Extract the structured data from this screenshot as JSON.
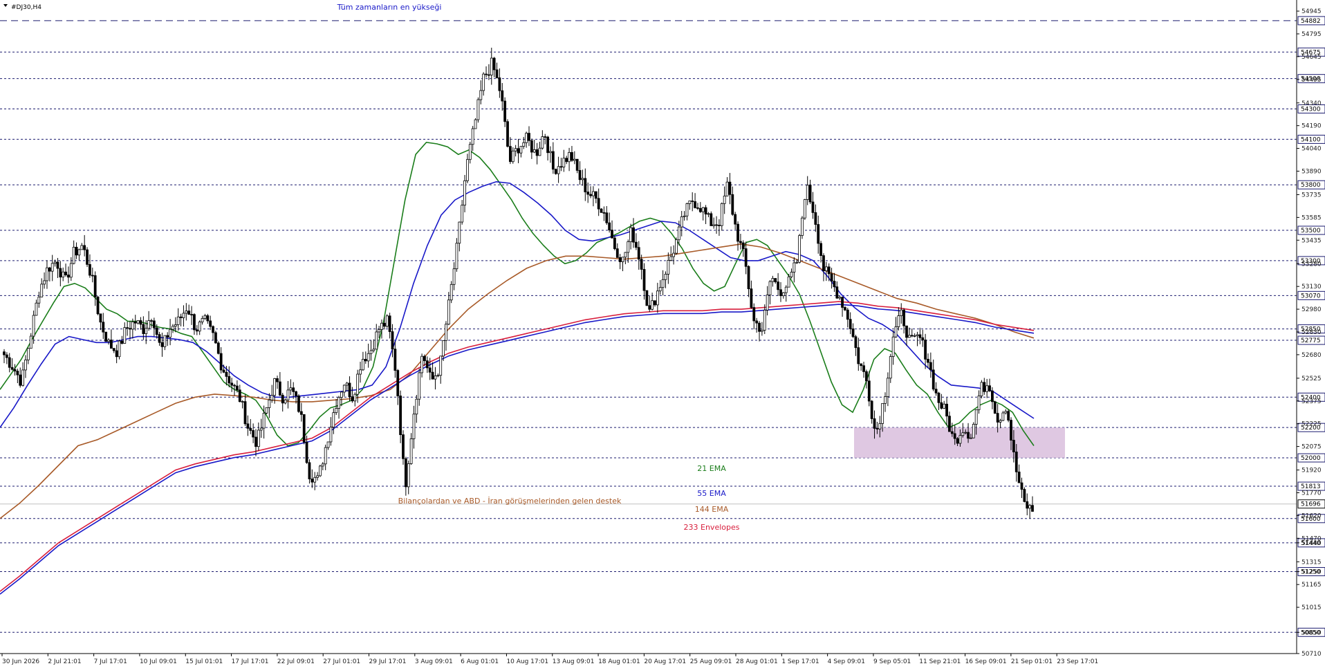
{
  "window": {
    "symbol_label": "#DJ30,H4",
    "menu_icon": "triangle-down-icon"
  },
  "chart_data": {
    "type": "candlestick",
    "title": "#DJ30,H4",
    "ylim": [
      50710,
      55000
    ],
    "x_ticks": [
      "30 Jun 2026",
      "2 Jul 21:01",
      "7 Jul 17:01",
      "10 Jul 09:01",
      "15 Jul 01:01",
      "17 Jul 17:01",
      "22 Jul 09:01",
      "27 Jul 01:01",
      "29 Jul 17:01",
      "3 Aug 09:01",
      "6 Aug 01:01",
      "10 Aug 17:01",
      "13 Aug 09:01",
      "18 Aug 01:01",
      "20 Aug 17:01",
      "25 Aug 09:01",
      "28 Aug 01:01",
      "1 Sep 17:01",
      "4 Sep 09:01",
      "9 Sep 05:01",
      "11 Sep 21:01",
      "16 Sep 09:01",
      "21 Sep 01:01",
      "23 Sep 17:01"
    ],
    "y_ticks": [
      50710,
      50850,
      51015,
      51165,
      51250,
      51315,
      51440,
      51470,
      51620,
      51770,
      51920,
      52075,
      52225,
      52375,
      52525,
      52680,
      52830,
      52980,
      53130,
      53280,
      53435,
      53585,
      53735,
      53890,
      54040,
      54190,
      54340,
      54495,
      54645,
      54795,
      54945
    ],
    "horizontal_levels": [
      {
        "value": 54882,
        "style": "dashed",
        "label": "54882"
      },
      {
        "value": 54675,
        "style": "dotted",
        "label": "54675"
      },
      {
        "value": 54500,
        "style": "dotted",
        "label": "54500"
      },
      {
        "value": 54300,
        "style": "dotted",
        "label": "54300"
      },
      {
        "value": 54100,
        "style": "dotted",
        "label": "54100"
      },
      {
        "value": 53800,
        "style": "dotted",
        "label": "53800"
      },
      {
        "value": 53500,
        "style": "dotted",
        "label": "53500"
      },
      {
        "value": 53300,
        "style": "dotted",
        "label": "53300"
      },
      {
        "value": 53070,
        "style": "dotted",
        "label": "53070"
      },
      {
        "value": 52850,
        "style": "dotted",
        "label": "52850"
      },
      {
        "value": 52775,
        "style": "dotted",
        "label": "52775"
      },
      {
        "value": 52400,
        "style": "dotted",
        "label": "52400"
      },
      {
        "value": 52200,
        "style": "dotted",
        "label": "52200"
      },
      {
        "value": 52000,
        "style": "dotted",
        "label": "52000"
      },
      {
        "value": 51813,
        "style": "dotted",
        "label": "51813"
      },
      {
        "value": 51600,
        "style": "dotted",
        "label": "51600"
      },
      {
        "value": 51440,
        "style": "dotted",
        "label": "51440"
      },
      {
        "value": 51250,
        "style": "dotted",
        "label": "51250"
      },
      {
        "value": 50850,
        "style": "dotted",
        "label": "50850"
      }
    ],
    "current_price": {
      "value": 51696,
      "label": "51696"
    },
    "support_zone": {
      "from": 52000,
      "to": 52200,
      "color": "#d9bedd"
    },
    "candles_anchor_close": [
      52680,
      52600,
      52500,
      52800,
      53100,
      53250,
      53300,
      53150,
      53350,
      53400,
      53200,
      52900,
      52750,
      52700,
      52850,
      52900,
      52850,
      52950,
      52700,
      52850,
      52900,
      53000,
      52850,
      52900,
      52800,
      52600,
      52500,
      52400,
      52200,
      52100,
      52300,
      52500,
      52400,
      52450,
      52300,
      51900,
      51850,
      52100,
      52350,
      52500,
      52400,
      52650,
      52700,
      52850,
      52900,
      52550,
      51800,
      52300,
      52700,
      52500,
      52600,
      53000,
      53400,
      53900,
      54200,
      54500,
      54600,
      54400,
      53950,
      54050,
      54100,
      54000,
      54150,
      53900,
      53950,
      54000,
      53850,
      53750,
      53700,
      53600,
      53400,
      53300,
      53500,
      53300,
      52950,
      53100,
      53250,
      53400,
      53600,
      53700,
      53650,
      53550,
      53550,
      53800,
      53500,
      53300,
      52900,
      52850,
      53200,
      53100,
      53150,
      53300,
      53800,
      53600,
      53250,
      53150,
      53050,
      52900,
      52650,
      52500,
      52150,
      52400,
      52800,
      52950,
      52750,
      52800,
      52650,
      52400,
      52300,
      52100,
      52200,
      52150,
      52450,
      52500,
      52250,
      52350,
      51950,
      51700,
      51650
    ],
    "series": [
      {
        "name": "21 EMA",
        "color": "#1a7d1a",
        "values": [
          52450,
          52550,
          52650,
          52780,
          52900,
          53020,
          53130,
          53150,
          53120,
          53050,
          52980,
          52950,
          52900,
          52900,
          52880,
          52860,
          52850,
          52820,
          52800,
          52700,
          52600,
          52500,
          52450,
          52420,
          52380,
          52280,
          52150,
          52080,
          52100,
          52180,
          52270,
          52330,
          52350,
          52380,
          52450,
          52600,
          52900,
          53300,
          53700,
          54000,
          54080,
          54070,
          54050,
          54000,
          54030,
          53980,
          53900,
          53800,
          53700,
          53580,
          53480,
          53400,
          53330,
          53280,
          53300,
          53350,
          53420,
          53450,
          53480,
          53520,
          53560,
          53580,
          53560,
          53480,
          53380,
          53250,
          53150,
          53100,
          53130,
          53280,
          53420,
          53440,
          53400,
          53300,
          53200,
          53080,
          52900,
          52700,
          52500,
          52350,
          52300,
          52450,
          52650,
          52720,
          52690,
          52580,
          52480,
          52420,
          52300,
          52200,
          52230,
          52300,
          52350,
          52380,
          52350,
          52300,
          52180,
          52080
        ]
      },
      {
        "name": "55 EMA",
        "color": "#1818c8",
        "values": [
          52200,
          52330,
          52480,
          52620,
          52750,
          52800,
          52780,
          52760,
          52760,
          52780,
          52800,
          52800,
          52790,
          52780,
          52760,
          52700,
          52620,
          52540,
          52480,
          52430,
          52400,
          52400,
          52410,
          52420,
          52430,
          52440,
          52450,
          52480,
          52600,
          52850,
          53150,
          53400,
          53600,
          53700,
          53750,
          53790,
          53820,
          53810,
          53750,
          53680,
          53600,
          53500,
          53440,
          53430,
          53450,
          53470,
          53500,
          53530,
          53560,
          53550,
          53500,
          53440,
          53380,
          53320,
          53300,
          53300,
          53330,
          53360,
          53340,
          53300,
          53200,
          53080,
          52990,
          52920,
          52880,
          52820,
          52720,
          52620,
          52540,
          52480,
          52470,
          52460,
          52440,
          52380,
          52320,
          52260
        ]
      },
      {
        "name": "144 EMA",
        "color": "#a85a28",
        "values": [
          51600,
          51700,
          51820,
          51950,
          52080,
          52120,
          52180,
          52240,
          52300,
          52360,
          52400,
          52420,
          52410,
          52400,
          52380,
          52370,
          52370,
          52380,
          52390,
          52410,
          52450,
          52550,
          52700,
          52850,
          52980,
          53080,
          53170,
          53250,
          53300,
          53330,
          53330,
          53320,
          53310,
          53320,
          53330,
          53350,
          53370,
          53390,
          53410,
          53390,
          53350,
          53300,
          53250,
          53200,
          53150,
          53100,
          53050,
          53020,
          52980,
          52950,
          52920,
          52880,
          52830,
          52790
        ]
      },
      {
        "name": "233 Envelopes",
        "color": "#d81e3c",
        "values": [
          51120,
          51220,
          51330,
          51440,
          51520,
          51600,
          51680,
          51760,
          51840,
          51920,
          51960,
          51990,
          52020,
          52040,
          52070,
          52100,
          52130,
          52200,
          52300,
          52400,
          52480,
          52560,
          52630,
          52690,
          52730,
          52760,
          52790,
          52820,
          52850,
          52880,
          52910,
          52930,
          52950,
          52960,
          52970,
          52970,
          52970,
          52980,
          52980,
          52990,
          53000,
          53010,
          53020,
          53030,
          53020,
          53000,
          52990,
          52970,
          52950,
          52930,
          52910,
          52880,
          52860,
          52840
        ]
      }
    ],
    "annotations": {
      "ath": "Tüm zamanların en yüksеği",
      "support_note": "Bilançolardan ve ABD - İran görüşmelerinden gelen destek",
      "ema21": "21 EMA",
      "ema55": "55 EMA",
      "ema144": "144 EMA",
      "env233": "233 Envelopes"
    },
    "colors": {
      "up_candle": "#ffffff",
      "down_candle": "#000000",
      "grid_dash": "#1a1a6e",
      "ath_text": "#1818c8",
      "support_text": "#a85a28"
    }
  }
}
